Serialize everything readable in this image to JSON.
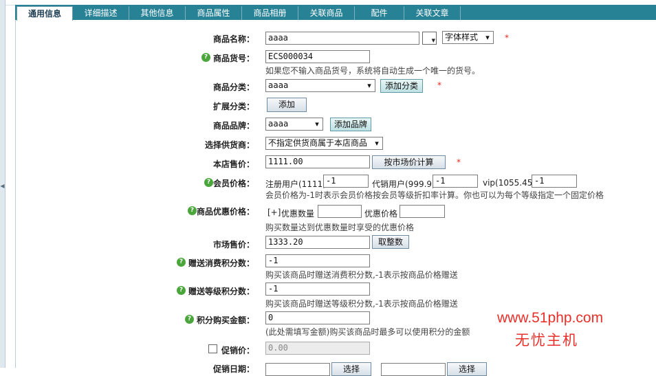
{
  "tabs": [
    {
      "label": "通用信息",
      "active": true
    },
    {
      "label": "详细描述",
      "active": false
    },
    {
      "label": "其他信息",
      "active": false
    },
    {
      "label": "商品属性",
      "active": false
    },
    {
      "label": "商品相册",
      "active": false
    },
    {
      "label": "关联商品",
      "active": false
    },
    {
      "label": "配件",
      "active": false
    },
    {
      "label": "关联文章",
      "active": false
    }
  ],
  "form": {
    "goods_name": {
      "label": "商品名称：",
      "value": "aaaa",
      "font_style": "字体样式",
      "required": "*"
    },
    "goods_sn": {
      "label": "商品货号：",
      "value": "ECS000034",
      "note": "如果您不输入商品货号，系统将自动生成一个唯一的货号。"
    },
    "category": {
      "label": "商品分类：",
      "value": "aaaa",
      "button": "添加分类",
      "required": "*"
    },
    "ext_category": {
      "label": "扩展分类：",
      "button": "添加"
    },
    "brand": {
      "label": "商品品牌：",
      "value": "aaaa",
      "button": "添加品牌"
    },
    "supplier": {
      "label": "选择供货商：",
      "value": "不指定供货商属于本店商品"
    },
    "shop_price": {
      "label": "本店售价：",
      "value": "1111.00",
      "button": "按市场价计算",
      "required": "*"
    },
    "member_price": {
      "label": "会员价格：",
      "levels": [
        {
          "name": "注册用户(1111)",
          "value": "-1"
        },
        {
          "name": "代销用户(999.9)",
          "value": "-1"
        },
        {
          "name": "vip(1055.45)",
          "value": "-1"
        }
      ],
      "note": "会员价格为-1时表示会员价格按会员等级折扣率计算。你也可以为每个等级指定一个固定价格"
    },
    "volume_price": {
      "label": "商品优惠价格：",
      "add": "[+]",
      "qty_label": "优惠数量",
      "price_label": "优惠价格",
      "note": "购买数量达到优惠数量时享受的优惠价格"
    },
    "market_price": {
      "label": "市场售价：",
      "value": "1333.20",
      "button": "取整数"
    },
    "give_integral": {
      "label": "赠送消费积分数：",
      "value": "-1",
      "note": "购买该商品时赠送消费积分数,-1表示按商品价格赠送"
    },
    "rank_integral": {
      "label": "赠送等级积分数：",
      "value": "-1",
      "note": "购买该商品时赠送等级积分数,-1表示按商品价格赠送"
    },
    "integral": {
      "label": "积分购买金额：",
      "value": "0",
      "note": "(此处需填写金额)购买该商品时最多可以使用积分的金额"
    },
    "promote": {
      "label": "促销价：",
      "value": "0.00",
      "checked": false
    },
    "promote_date": {
      "label": "促销日期：",
      "button1": "选择",
      "button2": "选择"
    }
  },
  "watermark": {
    "line1": "www.51php.com",
    "line2": "无忧主机"
  },
  "colors": {
    "tab_bar": "#278296",
    "required": "#e0261b",
    "help_icon": "#4aa63b",
    "watermark": "#e8302a"
  }
}
